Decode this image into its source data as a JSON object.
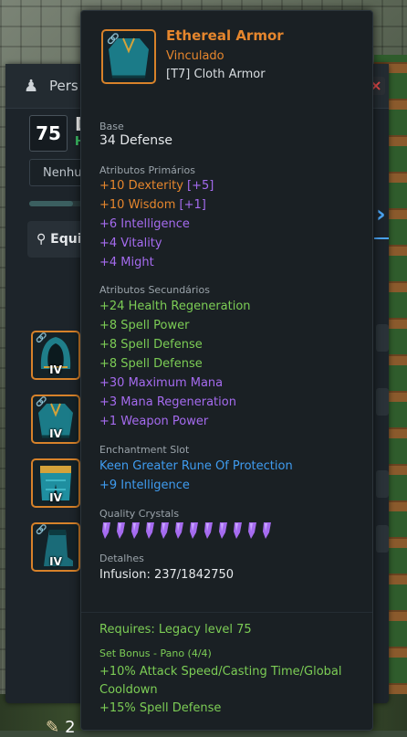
{
  "character_panel": {
    "title": "Pers",
    "level": "75",
    "name": "D",
    "subtitle": "H",
    "dropdown": "Nenhu",
    "equip_tab": "Equi",
    "slots": [
      "IV",
      "IV",
      "IV",
      "IV"
    ],
    "bottom_stat": "2"
  },
  "tooltip": {
    "item_tier": "IV",
    "item_name": "Ethereal Armor",
    "bound": "Vinculado",
    "type": "[T7] Cloth Armor",
    "base_label": "Base",
    "base_value": "34 Defense",
    "primary_label": "Atributos Primários",
    "primary": [
      {
        "text": "+10 Dexterity",
        "bonus": "[+5]"
      },
      {
        "text": "+10 Wisdom",
        "bonus": "[+1]"
      },
      {
        "text": "+6 Intelligence",
        "bonus": ""
      },
      {
        "text": "+4 Vitality",
        "bonus": ""
      },
      {
        "text": "+4 Might",
        "bonus": ""
      }
    ],
    "secondary_label": "Atributos Secundários",
    "secondary": [
      "+24 Health Regeneration",
      "+8 Spell Power",
      "+8 Spell Defense",
      "+8 Spell Defense",
      "+30 Maximum Mana",
      "+3 Mana Regeneration",
      "+1 Weapon Power"
    ],
    "enchant_label": "Enchantment Slot",
    "enchant_name": "Keen Greater Rune Of Protection",
    "enchant_stat": "+9 Intelligence",
    "crystals_label": "Quality Crystals",
    "crystal_count": 12,
    "details_label": "Detalhes",
    "infusion": "Infusion: 237/1842750",
    "requires": "Requires: Legacy level 75",
    "set_label": "Set Bonus - Pano (4/4)",
    "set_bonus_1": "+10% Attack Speed/Casting Time/Global Cooldown",
    "set_bonus_2": "+15% Spell Defense"
  },
  "colors": {
    "rarity_orange": "#e6862d",
    "primary_purple": "#a56bef",
    "secondary_green": "#7ccd55",
    "enchant_blue": "#3f9cf0"
  }
}
